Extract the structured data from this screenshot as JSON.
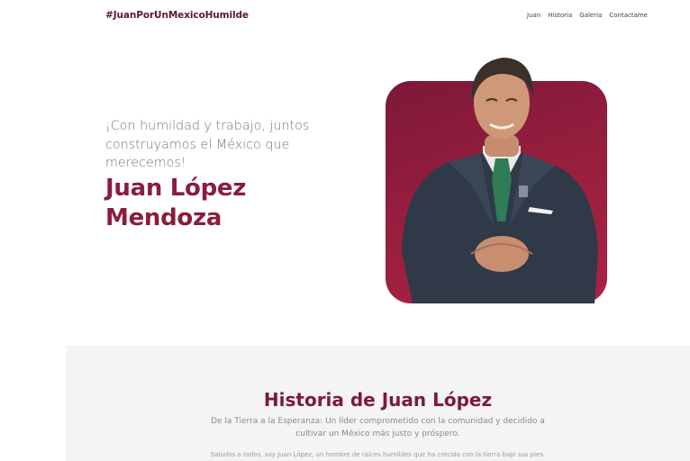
{
  "header": {
    "brand": "#JuanPorUnMexicoHumilde",
    "nav": [
      "Juan",
      "Historia",
      "Galeria",
      "Contactame"
    ]
  },
  "hero": {
    "tagline": "¡Con humildad y trabajo, juntos construyamos el México que merecemos!",
    "name": "Juan López Mendoza"
  },
  "historia": {
    "title": "Historia de Juan López",
    "subtitle": "De la Tierra a la Esperanza: Un líder comprometido con la comunidad y decidido a cultivar un México más justo y próspero.",
    "intro": "Saludos a todos, soy Juan López, un hombre de raíces humildes que ha crecido con la tierra bajo sus pies."
  },
  "colors": {
    "brand": "#5a1a28",
    "accent": "#8a1d3b",
    "section_bg": "#f4f4f5"
  }
}
